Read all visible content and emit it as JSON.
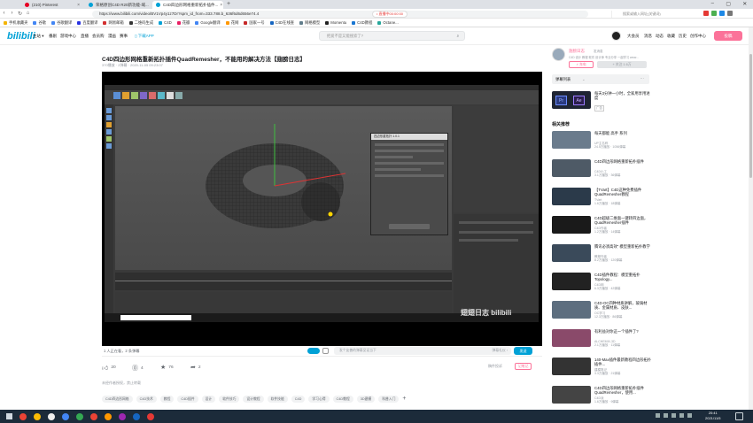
{
  "browser": {
    "tabs": [
      {
        "title": "(210) Pinterest",
        "color": "#e60023"
      },
      {
        "title": "荣格原创C4D R20新功能-域...",
        "color": "#00a1d6"
      },
      {
        "title": "C4D四边形网格重新拓扑插件...",
        "color": "#00a1d6",
        "active": true
      }
    ],
    "new_tab_symbol": "+",
    "tab_close_symbol": "×",
    "url": "https://www.bilibili.com/video/BV1Vp4y1z7Dr?spm_id_from=333.788.b_636f6d6d656e74.4",
    "status_pill": "• 直播中00:00:00",
    "right_search_placeholder": "搜索或输入网址(关键词)",
    "nav_symbols": [
      "‹",
      "›",
      "↻",
      "⌂"
    ],
    "bookmarks": [
      "手机收藏夹",
      "谷歌",
      "谷歌翻译",
      "百度翻译",
      "网易邮箱",
      "二维码生成",
      "C4D",
      "花瓣",
      "Google翻译",
      "花网",
      "国家一号",
      "C4D在线查",
      "网格模型",
      "Momentu",
      "C4D教程",
      "Octane..."
    ]
  },
  "bili_header": {
    "logo": "bilibili",
    "nav": [
      "主站 ▾",
      "番剧",
      "游戏中心",
      "直播",
      "会员购",
      "漫画",
      "赛事",
      "下载APP"
    ],
    "search_placeholder": "把爱不是又能搜索了?",
    "right_nav": [
      "大会员",
      "消息",
      "动态",
      "收藏",
      "历史",
      "创作中心"
    ],
    "upload": "投稿"
  },
  "video": {
    "title": "C4D四边形网格重新拓扑插件QuadRemesher，不能用的解决方法【翅膀日志】",
    "meta": "370播放 · 2弹幕 · 2020-11-05 09:23:07",
    "watermark": "翅翅日志 bilibili",
    "dialog_title": "四边形重拓扑 1.0.1"
  },
  "danmaku_bar": {
    "viewers": "1 人正在看，2 条弹幕",
    "input_placeholder": "发个友善的弹幕见证当下",
    "etiquette": "弹幕礼仪 ›",
    "send": "发送"
  },
  "actions": {
    "like": "20",
    "coin": "4",
    "favorite": "76",
    "share": "2",
    "report": "稿件投诉",
    "notes": "记笔记"
  },
  "desc": "未经作者授权，禁止转载",
  "tags": [
    "C4D四边形网格",
    "C4D技术",
    "教程",
    "C4D插件",
    "设计",
    "软件技巧",
    "设计教程",
    "软件技能",
    "C4D",
    "学习心得",
    "C4D教程",
    "3D建模",
    "科普入门"
  ],
  "sidebar": {
    "up_name": "翅膀日志",
    "up_badge": "发消息",
    "up_desc": "C4D 设计 教程 软件 设计师 专业分享 一起学习 www...",
    "charge": "⚡ 充电",
    "follow": "+ 关注 1.6万",
    "danmaku_list": "弹幕列表",
    "danmaku_more": "⋯",
    "ad_title": "每天3分钟一小时，全家用享用进度",
    "ad_tag": "广告",
    "related": "相关推荐",
    "recs": [
      {
        "title": "每天都能 高手 系列",
        "author": "UP主名称",
        "stats": "24.5万播放 · 1056弹幕",
        "thumb": "#6a7b8c"
      },
      {
        "title": "C4D四边形网格重新拓扑插件",
        "author": "C4D小工",
        "stats": "3.1万播放 · 36弹幕",
        "thumb": "#4e5a66"
      },
      {
        "title": "【TVart】C4D这种免费插件QuadRemesher教程",
        "author": "TVart",
        "stats": "1.6万播放 · 18弹幕",
        "thumb": "#2b3a4a"
      },
      {
        "title": "C4D超级二维面一键转四边面，QuadRemesher插件",
        "author": "C4D作者",
        "stats": "1.2万播放 · 14弹幕",
        "thumb": "#1a1a1a"
      },
      {
        "title": "腾讯必须高效“ 模型重新拓扑教学",
        "author": "教程作者",
        "stats": "8.2万播放 · 120弹幕",
        "thumb": "#3a4a5a"
      },
      {
        "title": "C4D插件教程：模型重拓扑 Topology...",
        "author": "C4D网",
        "stats": "6.3万播放 · 42弹幕",
        "thumb": "#222"
      },
      {
        "title": "C4D-OC四种材质讲解，玻璃材质、金属材质、皮肤...",
        "author": "OC学习",
        "stats": "12.3万播放 · 86弹幕",
        "thumb": "#5d6e7f"
      },
      {
        "title": "有利益对你这一个插件了?",
        "author": "ALCHEMIX-3D",
        "stats": "2.1万播放 · 11弹幕",
        "thumb": "#8a4a6a"
      },
      {
        "title": "140-Max插件最新教程四边形拓扑插件...",
        "author": "建模笔记",
        "stats": "3.3万播放 · 21弹幕",
        "thumb": "#333"
      },
      {
        "title": "C4D四边形网格重新拓扑插件QuadRemesher，使用...",
        "author": "C4D派",
        "stats": "1.6万播放 · 9弹幕",
        "thumb": "#444"
      }
    ]
  },
  "taskbar": {
    "search_placeholder": "在这里输入你要搜索的内容",
    "time": "20:41",
    "date": "2021/11/5"
  }
}
